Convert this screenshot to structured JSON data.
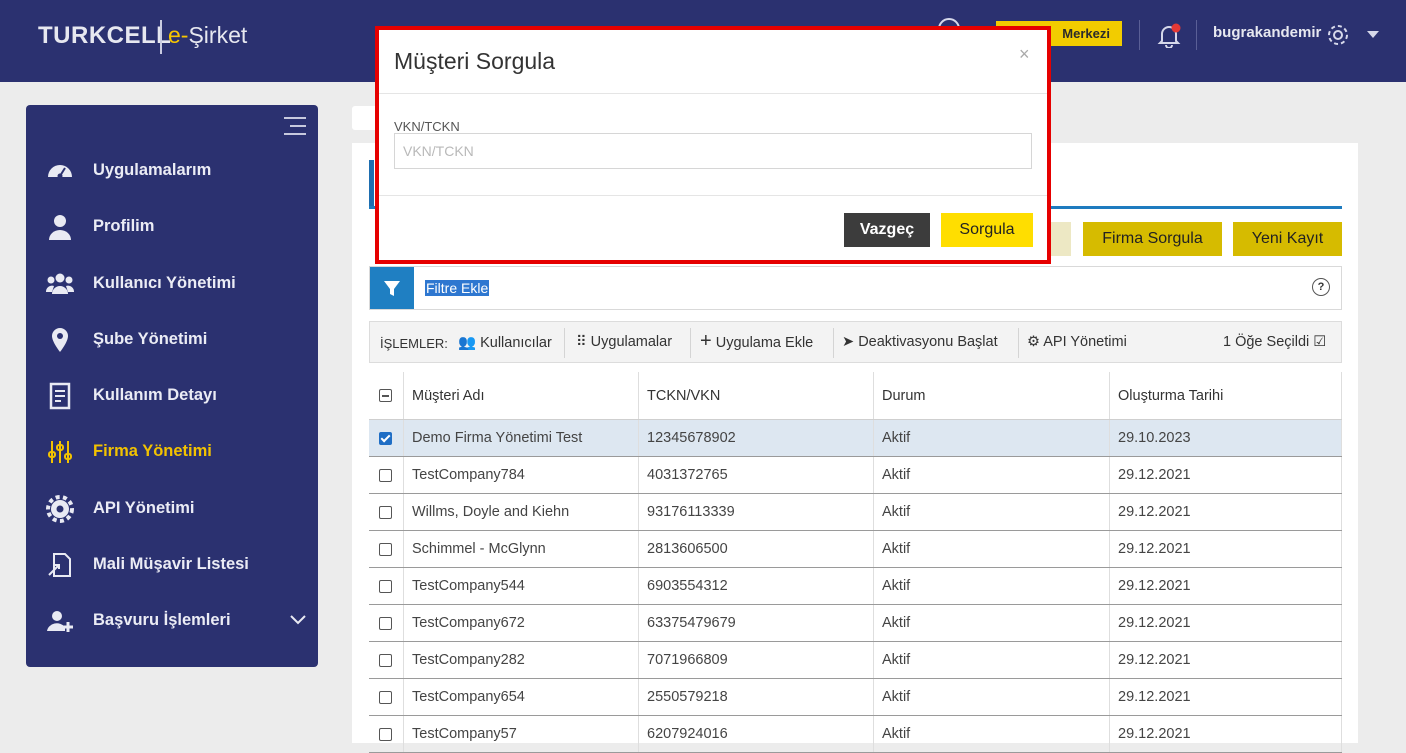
{
  "header": {
    "brand": "TURKCELL",
    "brand_sub_e": "e-",
    "brand_sub_rest": "Şirket",
    "help_center": "Merkezi",
    "username": "bugrakandemir",
    "accent": "#f2cc00",
    "bg": "#2b3170"
  },
  "sidebar": {
    "items": [
      {
        "label": "Uygulamalarım",
        "icon": "dashboard-icon"
      },
      {
        "label": "Profilim",
        "icon": "user-icon"
      },
      {
        "label": "Kullanıcı Yönetimi",
        "icon": "users-icon"
      },
      {
        "label": "Şube Yönetimi",
        "icon": "map-pin-icon"
      },
      {
        "label": "Kullanım Detayı",
        "icon": "document-icon"
      },
      {
        "label": "Firma Yönetimi",
        "icon": "sliders-icon",
        "active": true
      },
      {
        "label": "API Yönetimi",
        "icon": "gear-icon"
      },
      {
        "label": "Mali Müşavir Listesi",
        "icon": "file-export-icon"
      },
      {
        "label": "Başvuru İşlemleri",
        "icon": "user-plus-icon"
      }
    ]
  },
  "actions": {
    "firma_sorgula": "Firma Sorgula",
    "yeni_kayit": "Yeni Kayıt"
  },
  "filter": {
    "label": "Filtre Ekle",
    "help": "?"
  },
  "operations": {
    "title": "İŞLEMLER:",
    "kullanicilar": "Kullanıcılar",
    "uygulamalar": "Uygulamalar",
    "uygulama_ekle": "Uygulama Ekle",
    "deaktivasyon": "Deaktivasyonu Başlat",
    "api": "API Yönetimi",
    "selected": "1 Öğe Seçildi"
  },
  "table": {
    "columns": [
      "Müşteri Adı",
      "TCKN/VKN",
      "Durum",
      "Oluşturma Tarihi"
    ],
    "rows": [
      {
        "name": "Demo Firma Yönetimi Test",
        "id": "12345678902",
        "status": "Aktif",
        "date": "29.10.2023",
        "checked": true
      },
      {
        "name": "TestCompany784",
        "id": "4031372765",
        "status": "Aktif",
        "date": "29.12.2021"
      },
      {
        "name": "Willms, Doyle and Kiehn",
        "id": "93176113339",
        "status": "Aktif",
        "date": "29.12.2021"
      },
      {
        "name": "Schimmel - McGlynn",
        "id": "2813606500",
        "status": "Aktif",
        "date": "29.12.2021"
      },
      {
        "name": "TestCompany544",
        "id": "6903554312",
        "status": "Aktif",
        "date": "29.12.2021"
      },
      {
        "name": "TestCompany672",
        "id": "63375479679",
        "status": "Aktif",
        "date": "29.12.2021"
      },
      {
        "name": "TestCompany282",
        "id": "7071966809",
        "status": "Aktif",
        "date": "29.12.2021"
      },
      {
        "name": "TestCompany654",
        "id": "2550579218",
        "status": "Aktif",
        "date": "29.12.2021"
      },
      {
        "name": "TestCompany57",
        "id": "6207924016",
        "status": "Aktif",
        "date": "29.12.2021"
      }
    ]
  },
  "modal": {
    "title": "Müşteri Sorgula",
    "close": "×",
    "field_label": "VKN/TCKN",
    "field_placeholder": "VKN/TCKN",
    "field_value": "",
    "cancel": "Vazgeç",
    "submit": "Sorgula"
  }
}
